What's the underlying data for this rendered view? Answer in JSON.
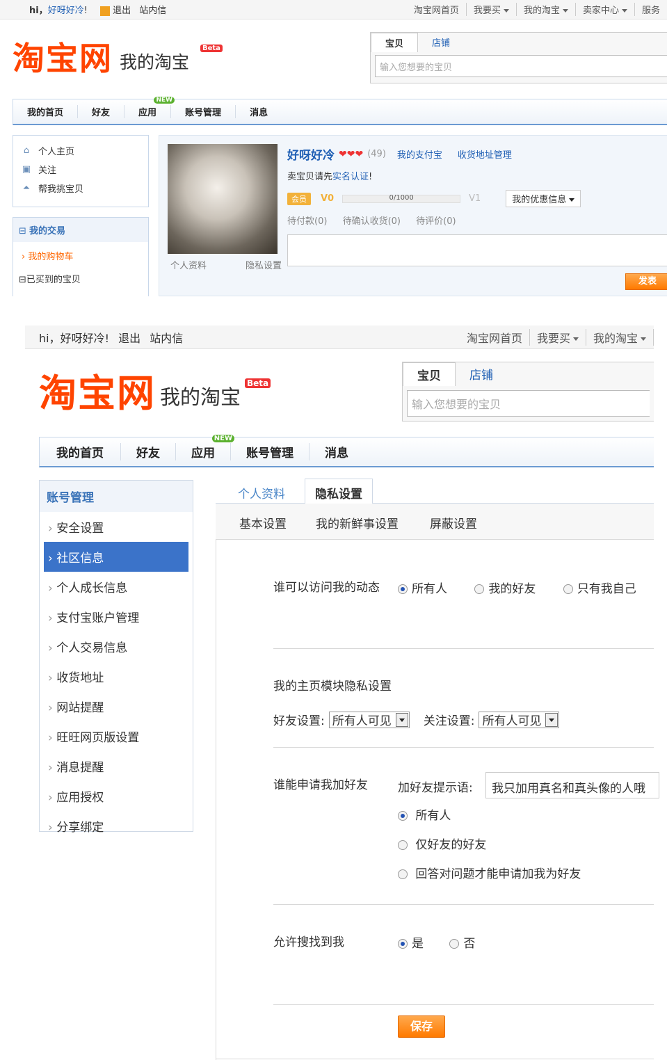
{
  "top1": {
    "greeting": "hi，",
    "username": "好呀好冷",
    "greeting_end": "!",
    "logout": "退出",
    "messages": "站内信",
    "nav": [
      "淘宝网首页",
      "我要买",
      "我的淘宝",
      "卖家中心",
      "服务"
    ]
  },
  "header1": {
    "logo": "淘宝网",
    "logo_sub": "我的淘宝",
    "beta": "Beta",
    "search_tabs": [
      "宝贝",
      "店铺"
    ],
    "search_placeholder": "输入您想要的宝贝"
  },
  "mainnav1": [
    "我的首页",
    "好友",
    "应用",
    "账号管理",
    "消息"
  ],
  "new_badge": "NEW",
  "side1": {
    "items": [
      "个人主页",
      "关注",
      "帮我挑宝贝"
    ],
    "trade_title": "我的交易",
    "cart": "我的购物车",
    "bought": "已买到的宝贝"
  },
  "profile": {
    "name": "好呀好冷",
    "score": "(49)",
    "alipay": "我的支付宝",
    "address": "收货地址管理",
    "verify_prefix": "卖宝贝请先",
    "verify_link": "实名认证",
    "verify_suffix": "!",
    "member": "会员",
    "v0": "V0",
    "progress_text": "0/1000",
    "progress_fraction": 0.0,
    "v1": "V1",
    "promo": "我的优惠信息",
    "pending": [
      "待付款(0)",
      "待确认收货(0)",
      "待评价(0)"
    ],
    "photo_links": [
      "个人资料",
      "隐私设置"
    ],
    "post_button": "发表"
  },
  "top2": {
    "greeting": "hi，好呀好冷!",
    "logout": "退出",
    "messages": "站内信",
    "nav": [
      "淘宝网首页",
      "我要买",
      "我的淘宝"
    ]
  },
  "header2": {
    "logo": "淘宝网",
    "logo_sub": "我的淘宝",
    "beta": "Beta",
    "search_tabs": [
      "宝贝",
      "店铺"
    ],
    "search_placeholder": "输入您想要的宝贝"
  },
  "mainnav2": [
    "我的首页",
    "好友",
    "应用",
    "账号管理",
    "消息"
  ],
  "account_menu": {
    "title": "账号管理",
    "items": [
      "安全设置",
      "社区信息",
      "个人成长信息",
      "支付宝账户管理",
      "个人交易信息",
      "收货地址",
      "网站提醒",
      "旺旺网页版设置",
      "消息提醒",
      "应用授权",
      "分享绑定"
    ],
    "active_index": 1
  },
  "settings": {
    "tabs": [
      "个人资料",
      "隐私设置"
    ],
    "subtabs": [
      "基本设置",
      "我的新鲜事设置",
      "屏蔽设置"
    ],
    "visit_label": "谁可以访问我的动态",
    "visit_options": [
      "所有人",
      "我的好友",
      "只有我自己"
    ],
    "module_title": "我的主页模块隐私设置",
    "friend_setting_label": "好友设置:",
    "friend_setting_value": "所有人可见",
    "follow_setting_label": "关注设置:",
    "follow_setting_value": "所有人可见",
    "apply_label": "谁能申请我加好友",
    "hint_label": "加好友提示语:",
    "hint_value": "我只加用真名和真头像的人哦",
    "apply_options": [
      "所有人",
      "仅好友的好友",
      "回答对问题才能申请加我为好友"
    ],
    "search_label": "允许搜找到我",
    "search_options": [
      "是",
      "否"
    ],
    "save": "保存"
  }
}
